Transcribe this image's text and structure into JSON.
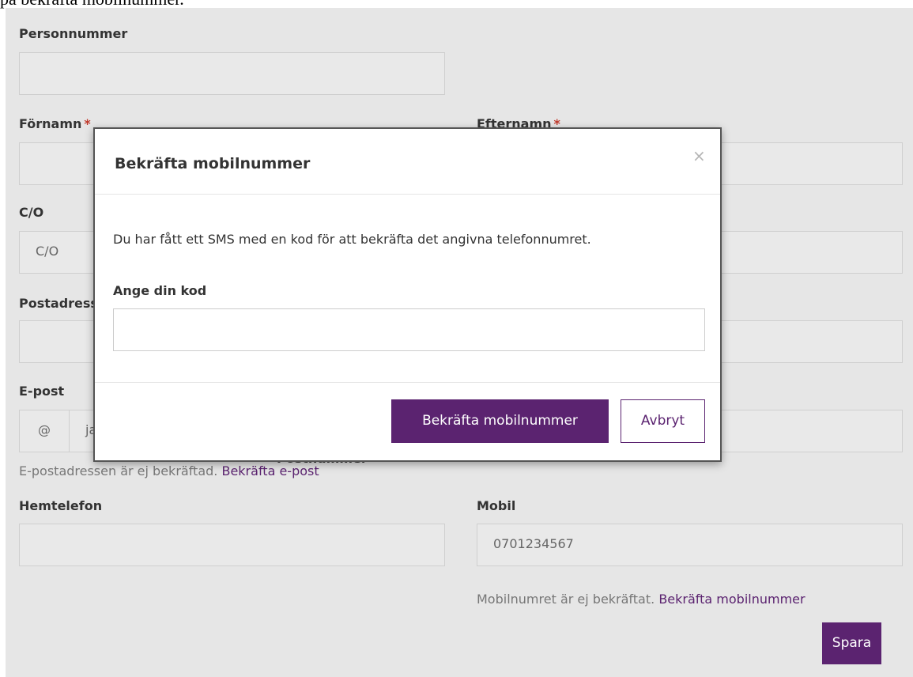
{
  "top_text": "på bekräfta mobilnummer.",
  "form": {
    "personnummer_label": "Personnummer",
    "fornamn_label": "Förnamn",
    "efternamn_label": "Efternamn",
    "required_mark": "*",
    "co_label": "C/O",
    "co_placeholder": "C/O",
    "postadress_label": "Postadress",
    "epost_label": "E-post",
    "epost_addon": "@",
    "epost_value": "ja",
    "epost_help": "E-postadressen är ej bekräftad.",
    "epost_link": "Bekräfta e-post",
    "postnummer_label": "Postnummer",
    "hemtelefon_label": "Hemtelefon",
    "mobil_label": "Mobil",
    "mobil_value": "0701234567",
    "mobil_help": "Mobilnumret är ej bekräftat.",
    "mobil_link": "Bekräfta mobilnummer",
    "save_label": "Spara"
  },
  "modal": {
    "title": "Bekräfta mobilnummer",
    "close_glyph": "×",
    "description": "Du har fått ett SMS med en kod för att bekräfta det angivna telefonnumret.",
    "code_label": "Ange din kod",
    "code_value": "",
    "confirm_label": "Bekräfta mobilnummer",
    "cancel_label": "Avbryt"
  },
  "colors": {
    "accent": "#5b2370",
    "required": "#c0392b",
    "overlay_background": "#e6e6e6"
  }
}
